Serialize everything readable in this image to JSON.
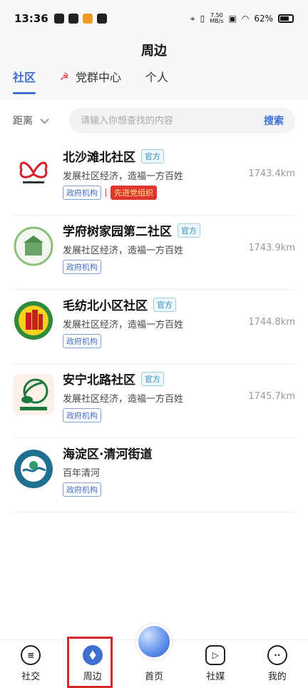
{
  "status": {
    "time": "13:36",
    "speed_top": "7.50",
    "speed_bottom": "MB/s",
    "battery": "62%"
  },
  "header": {
    "title": "周边"
  },
  "tabs": [
    {
      "label": "社区",
      "active": true
    },
    {
      "label": "党群中心",
      "active": false
    },
    {
      "label": "个人",
      "active": false
    }
  ],
  "search": {
    "filter_label": "距离",
    "placeholder": "请输入你想查找的内容",
    "button": "搜索"
  },
  "items": [
    {
      "name": "北沙滩北社区",
      "official": "官方",
      "desc": "发展社区经济，造福一方百姓",
      "distance": "1743.4km",
      "tags": [
        "政府机构"
      ],
      "extra_tag": "先进党组织",
      "logo": "butterfly-logo"
    },
    {
      "name": "学府树家园第二社区",
      "official": "官方",
      "desc": "发展社区经济，造福一方百姓",
      "distance": "1743.9km",
      "tags": [
        "政府机构"
      ],
      "logo": "building-seal-logo"
    },
    {
      "name": "毛纺北小区社区",
      "official": "官方",
      "desc": "发展社区经济，造福一方百姓",
      "distance": "1744.8km",
      "tags": [
        "政府机构"
      ],
      "logo": "red-building-logo"
    },
    {
      "name": "安宁北路社区",
      "official": "官方",
      "desc": "发展社区经济，造福一方百姓",
      "distance": "1745.7km",
      "tags": [
        "政府机构"
      ],
      "logo": "green-globe-logo"
    },
    {
      "name": "海淀区·清河街道",
      "desc": "百年清河",
      "tags": [
        "政府机构"
      ],
      "logo": "blue-seal-logo"
    }
  ],
  "nav": [
    {
      "label": "社交",
      "icon": "chat-icon"
    },
    {
      "label": "周边",
      "icon": "compass-icon",
      "active": true
    },
    {
      "label": "首页",
      "icon": "globe-icon"
    },
    {
      "label": "社媒",
      "icon": "play-icon"
    },
    {
      "label": "我的",
      "icon": "face-icon"
    }
  ]
}
